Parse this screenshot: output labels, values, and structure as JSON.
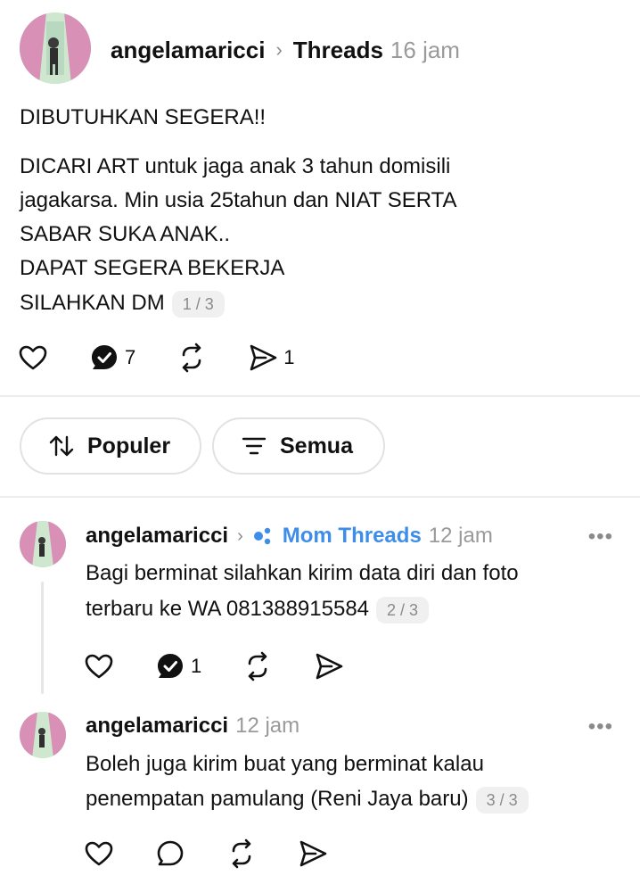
{
  "post": {
    "username": "angelamaricci",
    "topic": "Threads",
    "time": "16 jam",
    "lines": [
      "DIBUTUHKAN SEGERA!!",
      "DICARI ART untuk jaga anak 3 tahun domisili",
      "jagakarsa. Min usia 25tahun dan NIAT SERTA",
      "SABAR SUKA ANAK..",
      "DAPAT SEGERA BEKERJA",
      "SILAHKAN DM"
    ],
    "pager": "1 / 3",
    "reply_count": "7",
    "share_count": "1"
  },
  "filters": {
    "sort_label": "Populer",
    "filter_label": "Semua"
  },
  "replies": [
    {
      "username": "angelamaricci",
      "topic": "Mom Threads",
      "time": "12 jam",
      "more": "•••",
      "lines": [
        "Bagi berminat silahkan kirim data diri dan foto",
        "terbaru ke WA 081388915584"
      ],
      "pager": "2 / 3",
      "reply_count": "1"
    },
    {
      "username": "angelamaricci",
      "time": "12 jam",
      "more": "•••",
      "lines": [
        "Boleh juga kirim buat yang berminat kalau",
        "penempatan pamulang (Reni Jaya baru)"
      ],
      "pager": "3 / 3"
    }
  ],
  "colors": {
    "accent": "#3e8ee8",
    "muted": "#9a9a9a",
    "divider": "#ececec"
  },
  "icons": [
    "heart-icon",
    "reply-icon",
    "repost-icon",
    "share-icon",
    "sort-icon",
    "filter-icon",
    "mom-threads-topic-icon",
    "more-icon"
  ]
}
